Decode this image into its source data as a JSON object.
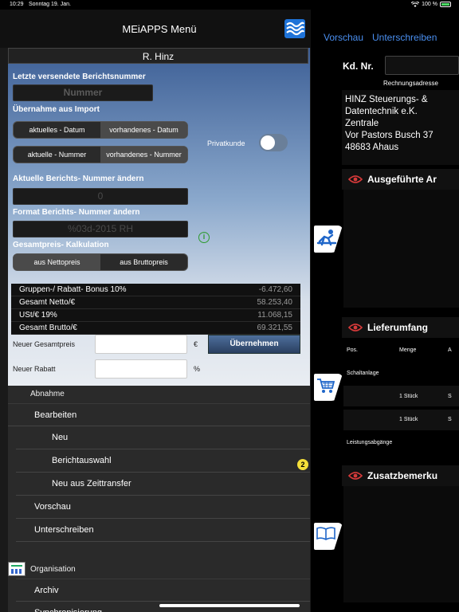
{
  "status_bar": {
    "time": "10:29",
    "date": "Sonntag 19. Jan.",
    "battery": "100 %"
  },
  "left_header": {
    "title": "MEiAPPS Menü",
    "icon": "waves-icon"
  },
  "sheet": {
    "title": "R. Hinz",
    "last_report_label": "Letzte versendete Berichtsnummer",
    "last_report_placeholder": "Nummer",
    "import_label": "Übernahme aus Import",
    "seg_date": [
      "aktuelles - Datum",
      "vorhandenes - Datum"
    ],
    "seg_number": [
      "aktuelle - Nummer",
      "vorhandenes - Nummer"
    ],
    "privat_label": "Privatkunde",
    "change_number_label": "Aktuelle Berichts- Nummer ändern",
    "change_number_value": "0",
    "format_label": "Format Berichts- Nummer ändern",
    "format_value": "%03d-2015 RH",
    "total_label": "Gesamtpreis- Kalkulation",
    "seg_price": [
      "aus Nettopreis",
      "aus Bruttopreis"
    ],
    "sums": [
      {
        "label": "Gruppen-/ Rabatt- Bonus 10%",
        "value": "-6.472,60"
      },
      {
        "label": "Gesamt Netto/€",
        "value": "58.253,40"
      },
      {
        "label": "USt/€ 19%",
        "value": "11.068,15"
      },
      {
        "label": "Gesamt Brutto/€",
        "value": "69.321,55"
      }
    ],
    "new_total_label": "Neuer Gesamtpreis",
    "currency_unit": "€",
    "new_discount_label": "Neuer Rabatt",
    "percent_unit": "%",
    "apply_button": "Übernehmen"
  },
  "menu": {
    "abnahme": "Abnahme",
    "bearbeiten": "Bearbeiten",
    "neu": "Neu",
    "berichtauswahl": "Berichtauswahl",
    "neu_zeittransfer": "Neu aus Zeittransfer",
    "vorschau": "Vorschau",
    "unterschreiben": "Unterschreiben",
    "organisation": "Organisation",
    "archiv": "Archiv",
    "synchronisierung": "Synchronisierung",
    "badge": "2"
  },
  "right": {
    "preview_link": "Vorschau",
    "sign_link": "Unterschreiben",
    "kd_label": "Kd. Nr.",
    "invoice_address_label": "Rechnungsadresse",
    "address_lines": [
      "HINZ Steuerungs- &",
      "Datentechnik e.K.",
      "Zentrale",
      "Vor Pastors Busch 37",
      "48683 Ahaus"
    ],
    "executed_title": "Ausgeführte Ar",
    "scope_title": "Lieferumfang",
    "col_pos": "Pos.",
    "col_qty": "Menge",
    "col_a": "A",
    "row_schaltanlage": "Schaltanlage",
    "qty_1": "1 Stück",
    "qty_2": "1 Stück",
    "col_s1": "S",
    "col_s2": "S",
    "row_leistung": "Leistungsabgänge",
    "extra_title": "Zusatzbemerku"
  },
  "accent_colors": {
    "link": "#4a8ff0",
    "eye": "#d63a3a",
    "badge": "#f5e03a"
  }
}
